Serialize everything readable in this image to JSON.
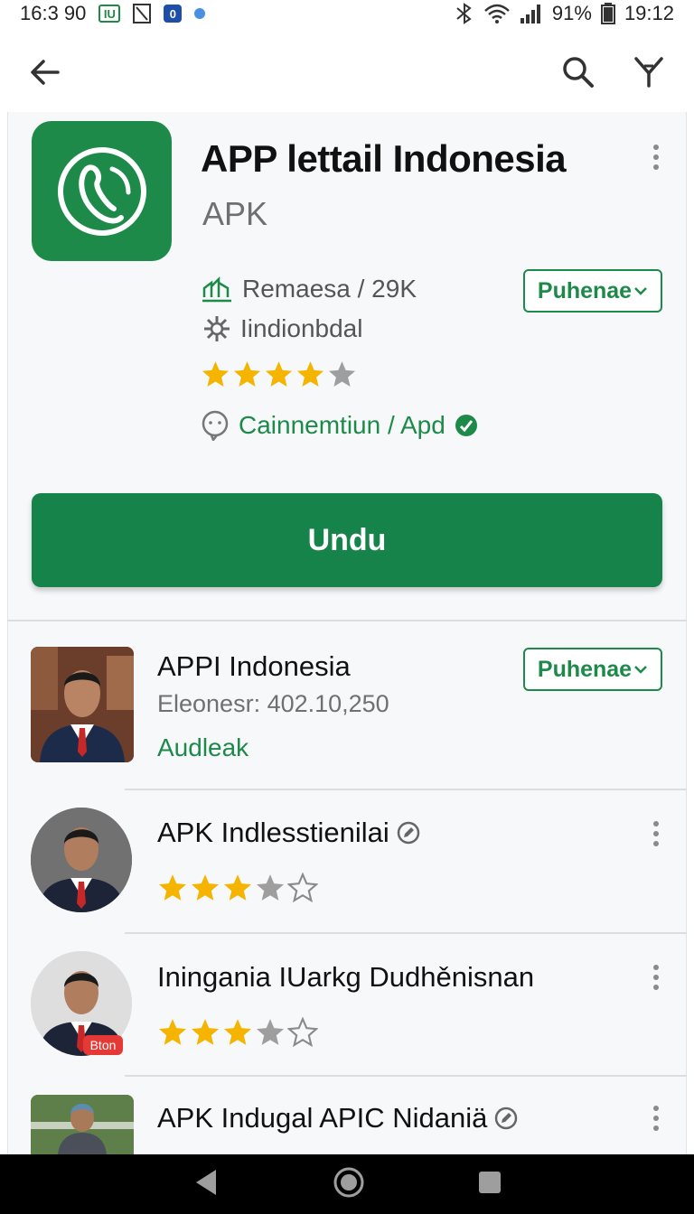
{
  "status": {
    "time_left": "16:3 90",
    "box_label": "IU",
    "blue_label": "0",
    "battery": "91%",
    "time_right": "19:12"
  },
  "header": {
    "title": "APP lettail Indonesia",
    "subtitle": "APK",
    "meta1": "Remaesa /  29K",
    "meta2": "Iindionbdal",
    "rating": 4,
    "link": "Cainnemtiun / Apd",
    "pill": "Puhenae",
    "download": "Undu"
  },
  "list": [
    {
      "title": "APPI Indonesia",
      "sub": "Eleonesr: 402.10,250",
      "green": "Audleak",
      "pill": "Puhenae"
    },
    {
      "title": "APK Indlesstienilai",
      "rating": 3.5
    },
    {
      "title": "Iningania IUarkg Dudhěnisnan",
      "rating": 3.5,
      "badge": "Bton"
    },
    {
      "title": "APK Indugal APIC Nidaniä"
    }
  ],
  "colors": {
    "brand": "#1d8a4a",
    "star": "#f5b400",
    "star_empty": "#9e9e9e"
  },
  "icons": [
    "back-arrow-icon",
    "search-icon",
    "filter-icon",
    "kebab-icon",
    "chart-icon",
    "gear-icon",
    "chat-icon",
    "verified-icon",
    "star-icon"
  ]
}
